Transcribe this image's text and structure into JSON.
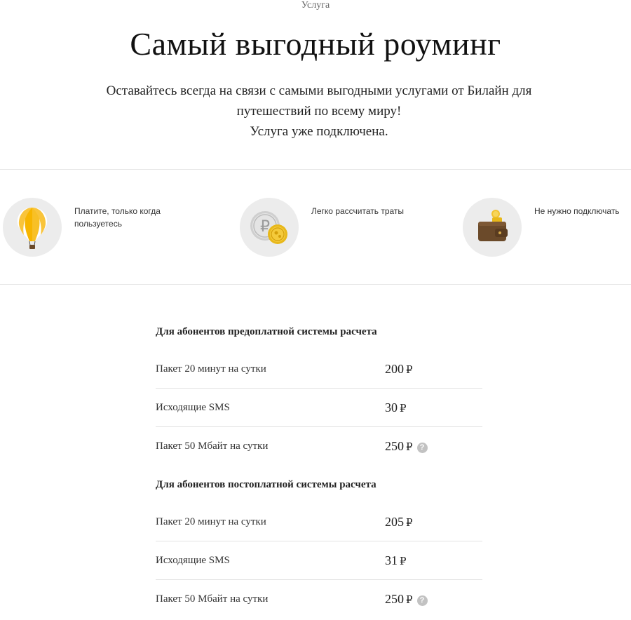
{
  "header": {
    "eyebrow": "Услуга",
    "title": "Самый выгодный роуминг",
    "subtitle_lines": [
      "Оставайтесь всегда на связи с самыми выгодными услугами от Билайн для",
      "путешествий по всему миру!",
      "Услуга уже подключена."
    ]
  },
  "features": [
    {
      "icon": "hot-air-balloon-icon",
      "text": "Платите, только когда пользуетесь"
    },
    {
      "icon": "coins-icon",
      "text": "Легко рассчитать траты"
    },
    {
      "icon": "wallet-icon",
      "text": "Не нужно подключать"
    }
  ],
  "tariffs": [
    {
      "title": "Для абонентов предоплатной системы расчета",
      "rows": [
        {
          "label": "Пакет 20 минут на сутки",
          "price": "200",
          "currency": "₽",
          "help": ""
        },
        {
          "label": "Исходящие SMS",
          "price": "30",
          "currency": "₽",
          "help": ""
        },
        {
          "label": "Пакет 50 Мбайт на сутки",
          "price": "250",
          "currency": "₽",
          "help": "?"
        }
      ]
    },
    {
      "title": "Для абонентов постоплатной системы расчета",
      "rows": [
        {
          "label": "Пакет 20 минут на сутки",
          "price": "205",
          "currency": "₽",
          "help": ""
        },
        {
          "label": "Исходящие SMS",
          "price": "31",
          "currency": "₽",
          "help": ""
        },
        {
          "label": "Пакет 50 Мбайт на сутки",
          "price": "250",
          "currency": "₽",
          "help": "?"
        }
      ]
    }
  ],
  "colors": {
    "accent": "#f7b500",
    "divider": "#e6e6e6",
    "icon_bg": "#ececec",
    "help_bg": "#c2c2c2"
  }
}
